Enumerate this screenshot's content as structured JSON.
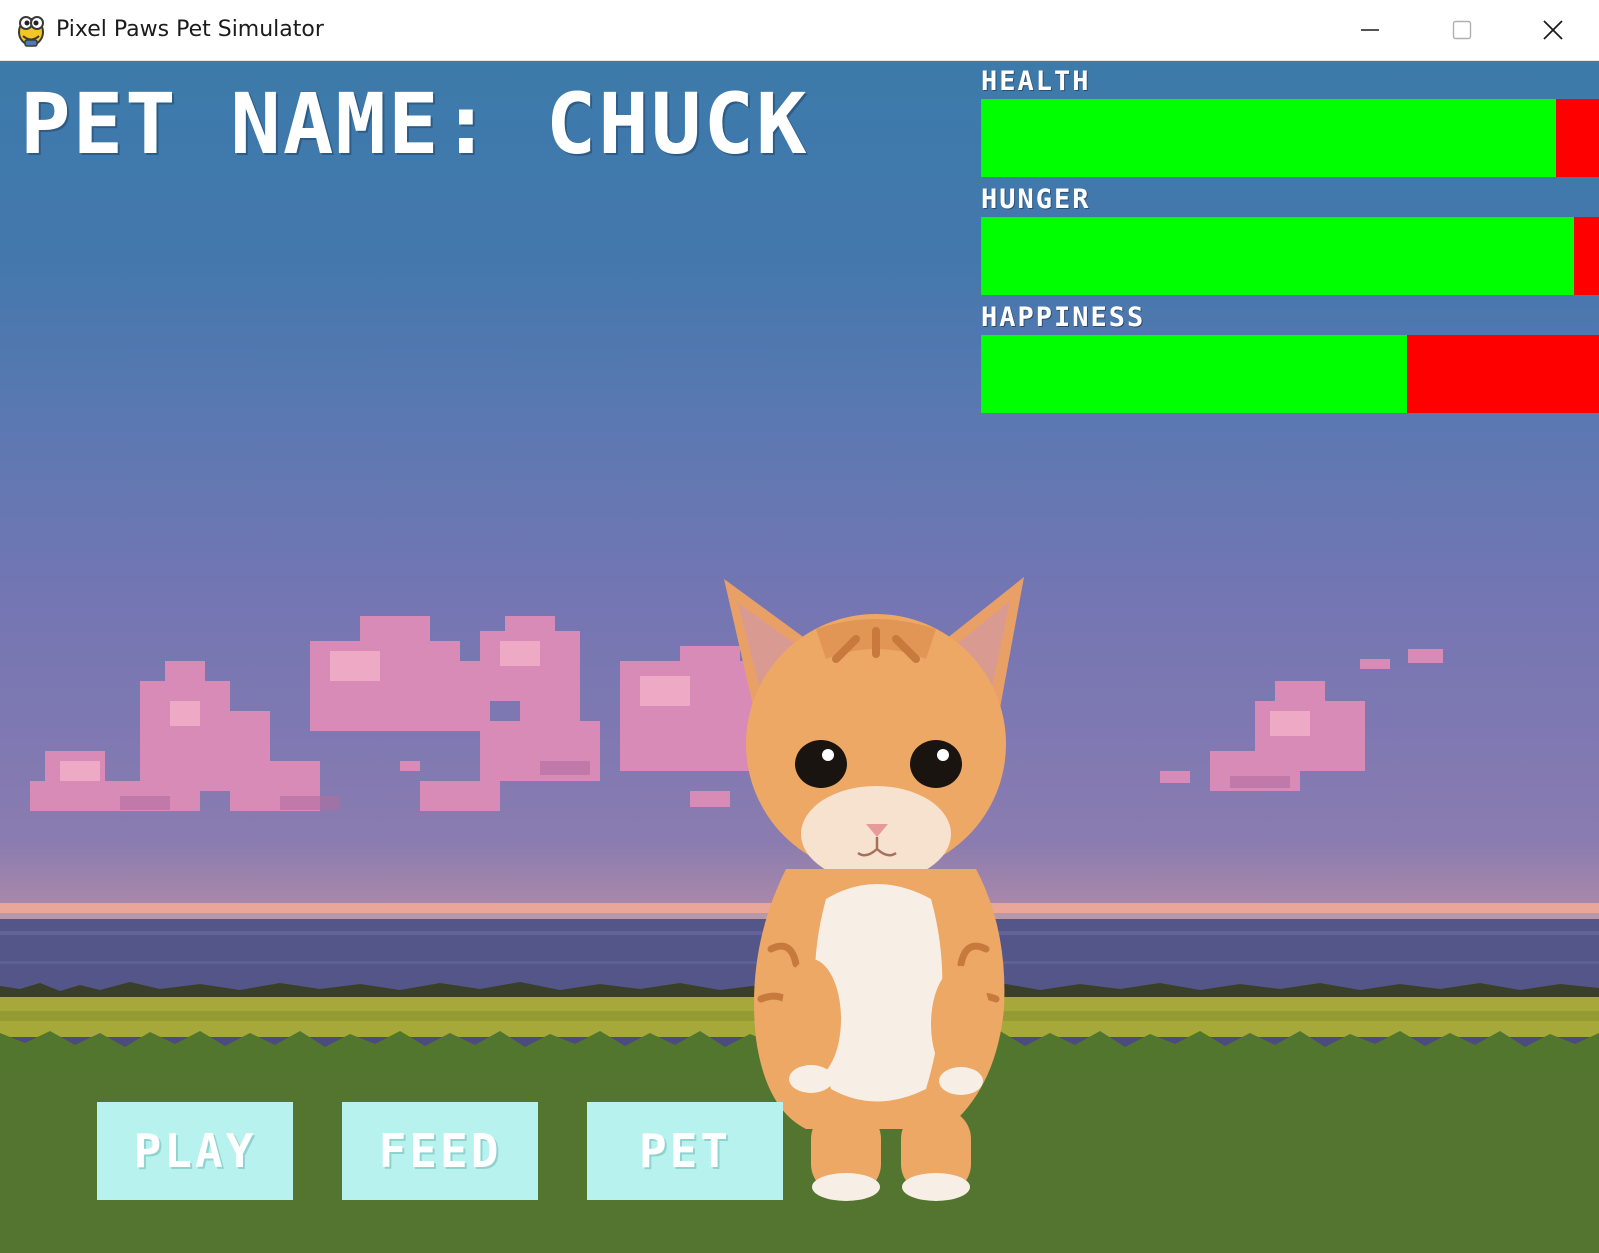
{
  "window": {
    "title": "Pixel Paws Pet Simulator",
    "icons": [
      "python-logo-icon",
      "minimize-icon",
      "maximize-icon",
      "close-icon"
    ]
  },
  "game": {
    "pet_name_text": "PET NAME: CHUCK",
    "stats": [
      {
        "label": "HEALTH",
        "fill_fraction": 0.93
      },
      {
        "label": "HUNGER",
        "fill_fraction": 0.96
      },
      {
        "label": "HAPPINESS",
        "fill_fraction": 0.69
      }
    ],
    "buttons": {
      "play": "PLAY",
      "feed": "FEED",
      "pet": "PET"
    },
    "colors": {
      "bar_fill": "#00ff00",
      "bar_empty": "#ff0000",
      "button_bg": "#b8f2ef",
      "sky_top": "#3c7aaa",
      "grass": "#53762e"
    },
    "pet_sprite": "orange-kitten"
  }
}
